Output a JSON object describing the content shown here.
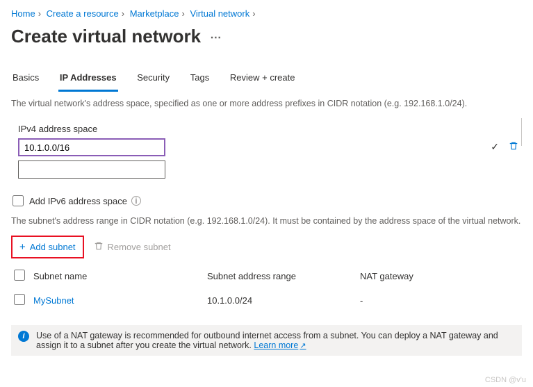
{
  "breadcrumb": [
    "Home",
    "Create a resource",
    "Marketplace",
    "Virtual network"
  ],
  "page_title": "Create virtual network",
  "tabs": [
    {
      "label": "Basics",
      "active": false
    },
    {
      "label": "IP Addresses",
      "active": true
    },
    {
      "label": "Security",
      "active": false
    },
    {
      "label": "Tags",
      "active": false
    },
    {
      "label": "Review + create",
      "active": false
    }
  ],
  "address_space": {
    "description": "The virtual network's address space, specified as one or more address prefixes in CIDR notation (e.g. 192.168.1.0/24).",
    "label": "IPv4 address space",
    "rows": [
      {
        "value": "10.1.0.0/16",
        "valid": true
      },
      {
        "value": "",
        "valid": false
      }
    ]
  },
  "ipv6_checkbox_label": "Add IPv6 address space",
  "subnet_description": "The subnet's address range in CIDR notation (e.g. 192.168.1.0/24). It must be contained by the address space of the virtual network.",
  "subnet_actions": {
    "add_label": "Add subnet",
    "remove_label": "Remove subnet"
  },
  "subnet_table": {
    "headers": {
      "name": "Subnet name",
      "range": "Subnet address range",
      "nat": "NAT gateway"
    },
    "rows": [
      {
        "name": "MySubnet",
        "range": "10.1.0.0/24",
        "nat": "-"
      }
    ]
  },
  "notice": {
    "text": "Use of a NAT gateway is recommended for outbound internet access from a subnet. You can deploy a NAT gateway and assign it to a subnet after you create the virtual network. ",
    "learn_more": "Learn more"
  },
  "watermark": "CSDN @v'u"
}
